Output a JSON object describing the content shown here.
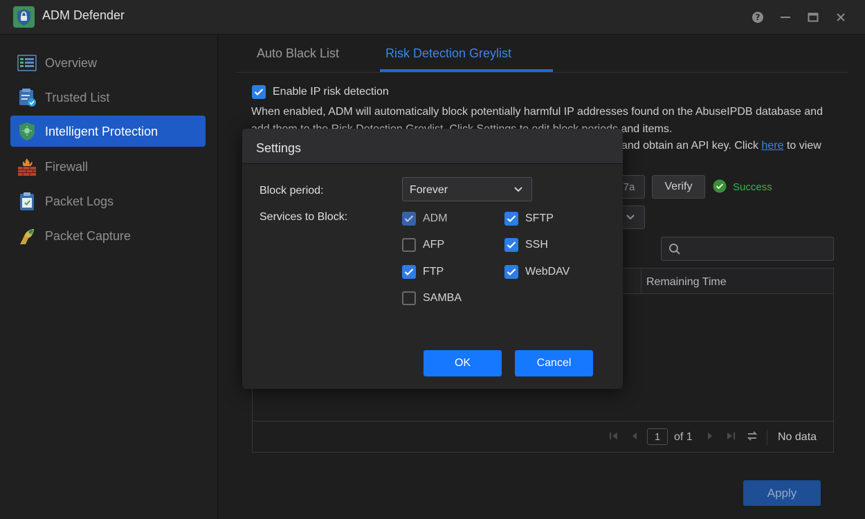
{
  "window": {
    "title": "ADM Defender"
  },
  "sidebar": {
    "items": [
      {
        "label": "Overview",
        "icon": "overview-icon"
      },
      {
        "label": "Trusted List",
        "icon": "trusted-list-icon"
      },
      {
        "label": "Intelligent Protection",
        "icon": "shield-icon",
        "active": true
      },
      {
        "label": "Firewall",
        "icon": "firewall-icon"
      },
      {
        "label": "Packet Logs",
        "icon": "clipboard-icon"
      },
      {
        "label": "Packet Capture",
        "icon": "packet-capture-icon"
      }
    ]
  },
  "tabs": [
    {
      "label": "Auto Black List"
    },
    {
      "label": "Risk Detection Greylist",
      "active": true
    }
  ],
  "main": {
    "enable_label": "Enable IP risk detection",
    "enable_checked": true,
    "desc_line1": "When enabled, ADM will automatically block potentially harmful IP addresses found on the AbuseIPDB database and",
    "desc_line2": "add them to the Risk Detection Greylist. Click Settings to edit block periods and items.",
    "desc_line3_pre": "and obtain an API key. Click",
    "desc_link": "here",
    "desc_line3_post": "to view",
    "api_key_fragment": "4e7a",
    "verify_label": "Verify",
    "status": "Success",
    "table_header_remaining": "Remaining Time",
    "page_current": "1",
    "page_of": "of 1",
    "no_data": "No data",
    "apply_label": "Apply"
  },
  "dialog": {
    "title": "Settings",
    "block_period_label": "Block period:",
    "block_period_value": "Forever",
    "services_label": "Services to Block:",
    "services": [
      {
        "label": "ADM",
        "checked": true,
        "disabled": true
      },
      {
        "label": "SFTP",
        "checked": true
      },
      {
        "label": "AFP",
        "checked": false
      },
      {
        "label": "SSH",
        "checked": true
      },
      {
        "label": "FTP",
        "checked": true
      },
      {
        "label": "WebDAV",
        "checked": true
      },
      {
        "label": "SAMBA",
        "checked": false
      }
    ],
    "ok_label": "OK",
    "cancel_label": "Cancel"
  },
  "colors": {
    "accent": "#1677ff",
    "active_nav": "#1f5bc6",
    "success": "#39b54a"
  }
}
